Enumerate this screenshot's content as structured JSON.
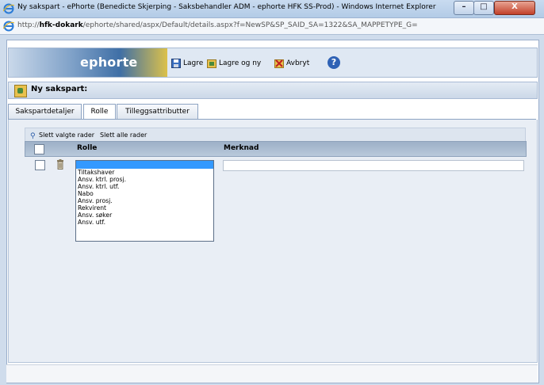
{
  "window": {
    "title": "Ny sakspart - ePhorte (Benedicte Skjerping - Saksbehandler ADM - ephorte HFK SS-Prod) - Windows Internet Explorer",
    "min_glyph": "–",
    "max_glyph": "□",
    "close_glyph": "X"
  },
  "address": {
    "prefix": "http://",
    "host": "hfk-dokark",
    "path": "/ephorte/shared/aspx/Default/details.aspx?f=NewSP&SP_SAID_SA=1322&SA_MAPPETYPE_G="
  },
  "brand": "ephorte",
  "toolbar": {
    "save": "Lagre",
    "save_new": "Lagre og ny",
    "cancel": "Avbryt",
    "help": "?"
  },
  "header": {
    "title": "Ny sakspart:"
  },
  "tabs": [
    {
      "label": "Sakspartdetaljer"
    },
    {
      "label": "Rolle"
    },
    {
      "label": "Tilleggsattributter"
    }
  ],
  "active_tab": "Rolle",
  "grid": {
    "delete_selected": "Slett valgte rader",
    "delete_all": "Slett alle rader",
    "columns": [
      "Rolle",
      "Merknad"
    ]
  },
  "role_select": {
    "selected": "",
    "options": [
      "",
      "Tiltakshaver",
      "Ansv. ktrl. prosj.",
      "Ansv. ktrl. utf.",
      "Nabo",
      "Ansv. prosj.",
      "Rekvirent",
      "Ansv. søker",
      "Ansv. utf."
    ]
  },
  "merknad_value": "",
  "colors": {
    "selection": "#3399ff",
    "grid_header": "#9db0c7",
    "panel": "#e9eef5"
  }
}
